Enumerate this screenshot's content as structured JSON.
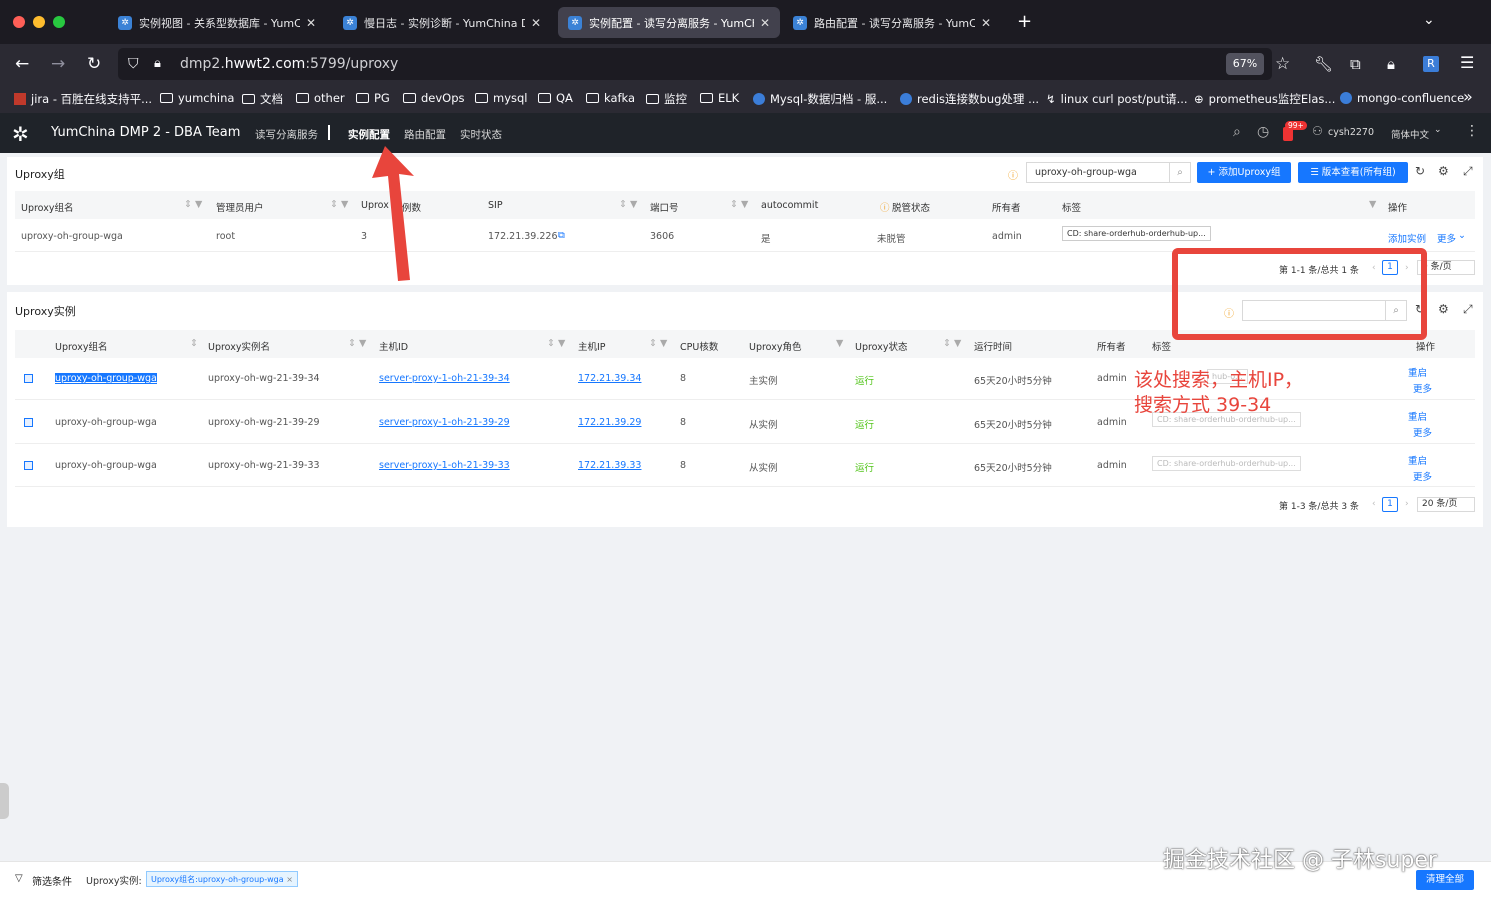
{
  "browser": {
    "tabs": [
      {
        "label": "实例视图 - 关系型数据库 - YumCh"
      },
      {
        "label": "慢日志 - 实例诊断 - YumChina D"
      },
      {
        "label": "实例配置 - 读写分离服务 - YumCh"
      },
      {
        "label": "路由配置 - 读写分离服务 - YumCh"
      }
    ],
    "url_prefix": "dmp2.",
    "url_domain": "hwwt2.com",
    "url_suffix": ":5799/uproxy",
    "zoom": "67%",
    "bookmarks": [
      "jira - 百胜在线支持平...",
      "yumchina",
      "文档",
      "other",
      "PG",
      "devOps",
      "mysql",
      "QA",
      "kafka",
      "监控",
      "ELK",
      "Mysql-数据归档 - 服...",
      "redis连接数bug处理 ...",
      "linux curl post/put请...",
      "prometheus监控Elas...",
      "mongo-confluence"
    ]
  },
  "app": {
    "title": "YumChina DMP 2 - DBA Team",
    "nav": [
      "读写分离服务",
      "实例配置",
      "路由配置",
      "实时状态"
    ],
    "notif_count": "99+",
    "user": "cysh2270",
    "lang": "简体中文"
  },
  "group_card": {
    "title": "Uproxy组",
    "search_value": "uproxy-oh-group-wga",
    "add_button": "+ 添加Uproxy组",
    "version_button": "☰ 版本查看(所有组)",
    "headers": [
      "Uproxy组名",
      "管理员用户",
      "Uprox",
      "例数",
      "SIP",
      "端口号",
      "autocommit",
      "脱管状态",
      "所有者",
      "标签",
      "操作"
    ],
    "row": {
      "name": "uproxy-oh-group-wga",
      "admin_user": "root",
      "instances": "3",
      "sip": "172.21.39.226",
      "port": "3606",
      "autocommit": "是",
      "managed": "未脱管",
      "owner": "admin",
      "tag": "CD: share-orderhub-orderhub-up...",
      "op_add": "添加实例",
      "op_more": "更多"
    },
    "pager": {
      "summary": "第 1-1 条/总共 1 条",
      "page": "1",
      "size": "0 条/页"
    }
  },
  "instance_card": {
    "title": "Uproxy实例",
    "search_value": "",
    "headers": [
      "Uproxy组名",
      "Uproxy实例名",
      "主机ID",
      "主机IP",
      "CPU核数",
      "Uproxy角色",
      "Uproxy状态",
      "运行时间",
      "所有者",
      "标签",
      "操作"
    ],
    "rows": [
      {
        "group": "uproxy-oh-group-wga",
        "instance": "uproxy-oh-wg-21-39-34",
        "host_id": "server-proxy-1-oh-21-39-34",
        "host_ip": "172.21.39.34",
        "cpu": "8",
        "role": "主实例",
        "status": "运行",
        "uptime": "65天20小时5分钟",
        "owner": "admin",
        "tag": "hub-o...",
        "op_restart": "重启",
        "op_more": "更多"
      },
      {
        "group": "uproxy-oh-group-wga",
        "instance": "uproxy-oh-wg-21-39-29",
        "host_id": "server-proxy-1-oh-21-39-29",
        "host_ip": "172.21.39.29",
        "cpu": "8",
        "role": "从实例",
        "status": "运行",
        "uptime": "65天20小时5分钟",
        "owner": "admin",
        "tag": "CD: share-orderhub-orderhub-up...",
        "op_restart": "重启",
        "op_more": "更多"
      },
      {
        "group": "uproxy-oh-group-wga",
        "instance": "uproxy-oh-wg-21-39-33",
        "host_id": "server-proxy-1-oh-21-39-33",
        "host_ip": "172.21.39.33",
        "cpu": "8",
        "role": "从实例",
        "status": "运行",
        "uptime": "65天20小时5分钟",
        "owner": "admin",
        "tag": "CD: share-orderhub-orderhub-up...",
        "op_restart": "重启",
        "op_more": "更多"
      }
    ],
    "pager": {
      "summary": "第 1-3 条/总共 3 条",
      "page": "1",
      "size": "20 条/页"
    }
  },
  "annotation": {
    "line1": "该处搜索，主机IP，",
    "line2": "搜索方式 39-34"
  },
  "watermark": "掘金技术社区 @ 子林super",
  "footer": {
    "filter_label": "筛选条件",
    "scope": "Uproxy实例:",
    "chip": "Uproxy组名:uproxy-oh-group-wga",
    "clear": "清理全部"
  },
  "colors": {
    "accent": "#1677ff",
    "annotation": "#e8453c",
    "running": "#52c41a"
  }
}
